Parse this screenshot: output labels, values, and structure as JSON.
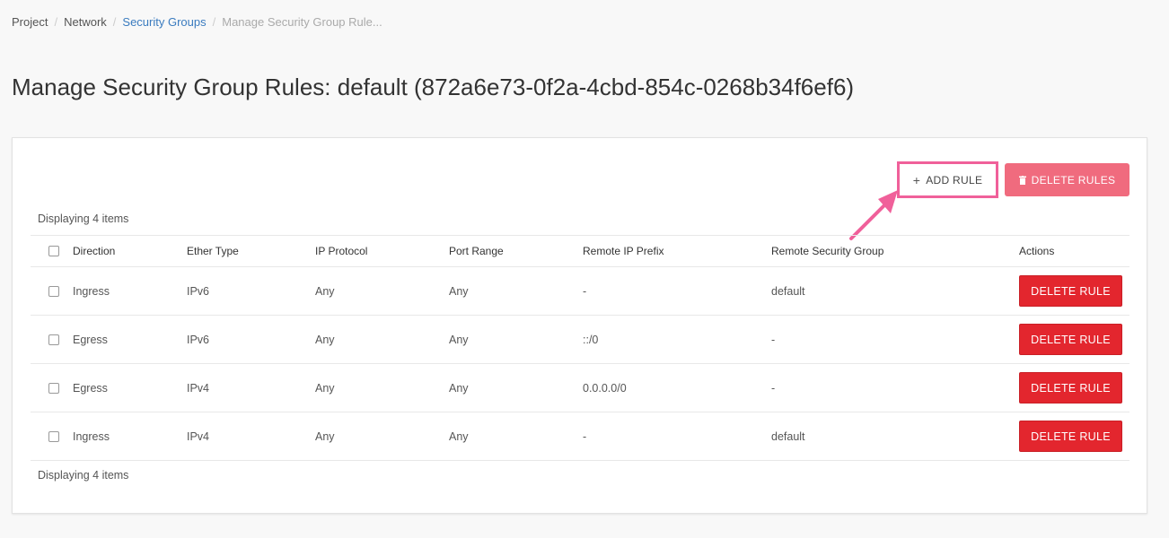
{
  "breadcrumb": {
    "items": [
      "Project",
      "Network",
      "Security Groups",
      "Manage Security Group Rule..."
    ]
  },
  "page": {
    "title": "Manage Security Group Rules: default (872a6e73-0f2a-4cbd-854c-0268b34f6ef6)"
  },
  "toolbar": {
    "add_rule_label": "ADD RULE",
    "add_rule_icon": "plus-icon",
    "delete_rules_label": "DELETE RULES",
    "delete_rules_icon": "trash-icon"
  },
  "table": {
    "count_top": "Displaying 4 items",
    "count_bottom": "Displaying 4 items",
    "headers": [
      "Direction",
      "Ether Type",
      "IP Protocol",
      "Port Range",
      "Remote IP Prefix",
      "Remote Security Group",
      "Actions"
    ],
    "rows": [
      {
        "direction": "Ingress",
        "ether_type": "IPv6",
        "ip_protocol": "Any",
        "port_range": "Any",
        "remote_ip_prefix": "-",
        "remote_security_group": "default",
        "action_label": "DELETE RULE"
      },
      {
        "direction": "Egress",
        "ether_type": "IPv6",
        "ip_protocol": "Any",
        "port_range": "Any",
        "remote_ip_prefix": "::/0",
        "remote_security_group": "-",
        "action_label": "DELETE RULE"
      },
      {
        "direction": "Egress",
        "ether_type": "IPv4",
        "ip_protocol": "Any",
        "port_range": "Any",
        "remote_ip_prefix": "0.0.0.0/0",
        "remote_security_group": "-",
        "action_label": "DELETE RULE"
      },
      {
        "direction": "Ingress",
        "ether_type": "IPv4",
        "ip_protocol": "Any",
        "port_range": "Any",
        "remote_ip_prefix": "-",
        "remote_security_group": "default",
        "action_label": "DELETE RULE"
      }
    ]
  },
  "colors": {
    "link": "#3a7bbf",
    "highlight": "#f0609a",
    "delete_rules": "#f06b7e",
    "delete_rule": "#e3262e"
  }
}
